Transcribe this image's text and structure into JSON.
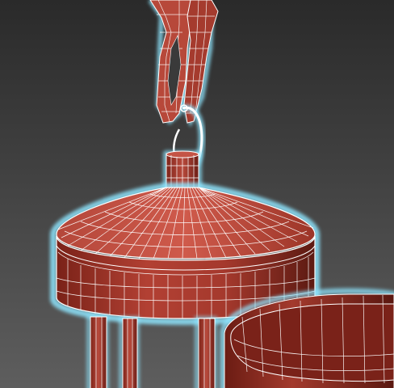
{
  "viewport": {
    "background_top": "#2a2a2a",
    "background_bottom": "#5e5e5e",
    "mesh_face_light": "#c04a3c",
    "mesh_face_mid": "#9c3328",
    "mesh_face_dark": "#5a1a12",
    "wire_color": "#ffffff",
    "selection_glow": "#8fe6ff",
    "selected_edge_highlight": "#ffffff"
  },
  "scene": {
    "objects": [
      "chain-links",
      "hook-ring",
      "cap-collar",
      "lamp-cap",
      "cap-rim",
      "support-rods",
      "glass-cylinder"
    ]
  }
}
